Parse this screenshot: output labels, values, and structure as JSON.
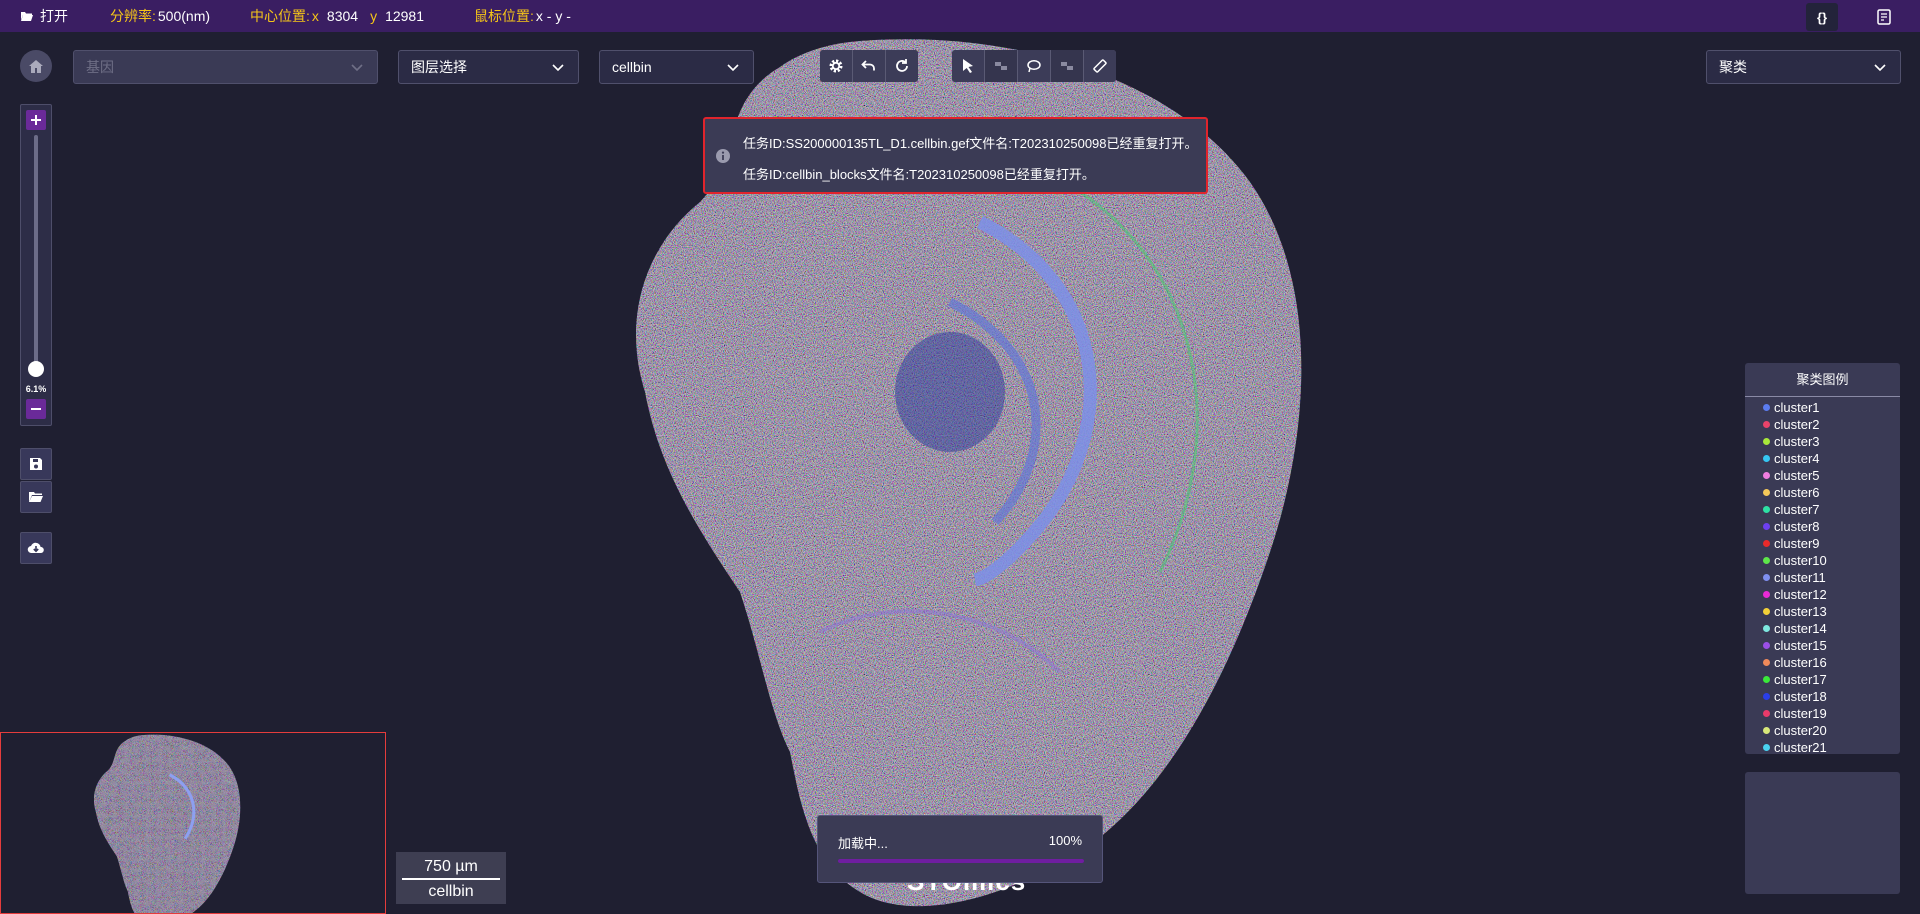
{
  "topbar": {
    "open_label": "打开",
    "resolution_label": "分辨率:",
    "resolution_value": "500(nm)",
    "center_label": "中心位置:",
    "center_x_axis": "x",
    "center_x": "8304",
    "center_y_axis": "y",
    "center_y": "12981",
    "mouse_label": "鼠标位置:",
    "mouse_value": "x -  y -",
    "json_label": "{}"
  },
  "toolbar": {
    "gene_placeholder": "基因",
    "layer_select": "图层选择",
    "bin_select": "cellbin",
    "cluster_select": "聚类"
  },
  "zoom": {
    "level_label": "6.1%",
    "level": 0.061
  },
  "notice": {
    "line1": "任务ID:SS200000135TL_D1.cellbin.gef文件名:T202310250098已经重复打开。",
    "line2": "任务ID:cellbin_blocks文件名:T202310250098已经重复打开。"
  },
  "legend": {
    "title": "聚类图例",
    "items": [
      {
        "label": "cluster1",
        "color": "#5b7cf0"
      },
      {
        "label": "cluster2",
        "color": "#e8436a"
      },
      {
        "label": "cluster3",
        "color": "#a8e83a"
      },
      {
        "label": "cluster4",
        "color": "#35c6f2"
      },
      {
        "label": "cluster5",
        "color": "#f07de0"
      },
      {
        "label": "cluster6",
        "color": "#f4c85a"
      },
      {
        "label": "cluster7",
        "color": "#2ee0a4"
      },
      {
        "label": "cluster8",
        "color": "#6d3ff0"
      },
      {
        "label": "cluster9",
        "color": "#e82a2a"
      },
      {
        "label": "cluster10",
        "color": "#5ee64a"
      },
      {
        "label": "cluster11",
        "color": "#7f8ff0"
      },
      {
        "label": "cluster12",
        "color": "#e82ad6"
      },
      {
        "label": "cluster13",
        "color": "#f2d038"
      },
      {
        "label": "cluster14",
        "color": "#7ee8e0"
      },
      {
        "label": "cluster15",
        "color": "#9a4fe6"
      },
      {
        "label": "cluster16",
        "color": "#f08a5a"
      },
      {
        "label": "cluster17",
        "color": "#3ae83a"
      },
      {
        "label": "cluster18",
        "color": "#2a3ee8"
      },
      {
        "label": "cluster19",
        "color": "#e83a6a"
      },
      {
        "label": "cluster20",
        "color": "#d8e87a"
      },
      {
        "label": "cluster21",
        "color": "#4ad2f0"
      }
    ]
  },
  "scalebar": {
    "value": "750 µm",
    "unit_label": "cellbin"
  },
  "progress": {
    "label": "加载中...",
    "percent_label": "100%",
    "fraction": 1.0
  },
  "brand": "STOmics",
  "icons": {
    "open": "folder-open-icon",
    "json": "braces-icon",
    "note": "note-icon",
    "home": "home-icon",
    "settings": "gear-icon",
    "undo": "undo-icon",
    "redo": "redo-icon",
    "select": "pointer-icon",
    "rect": "rect-select-icon",
    "lasso": "lasso-icon",
    "brush": "brush-select-icon",
    "ruler": "ruler-icon",
    "save": "save-icon",
    "folder": "folder-icon",
    "download": "cloud-download-icon",
    "info": "info-icon"
  }
}
